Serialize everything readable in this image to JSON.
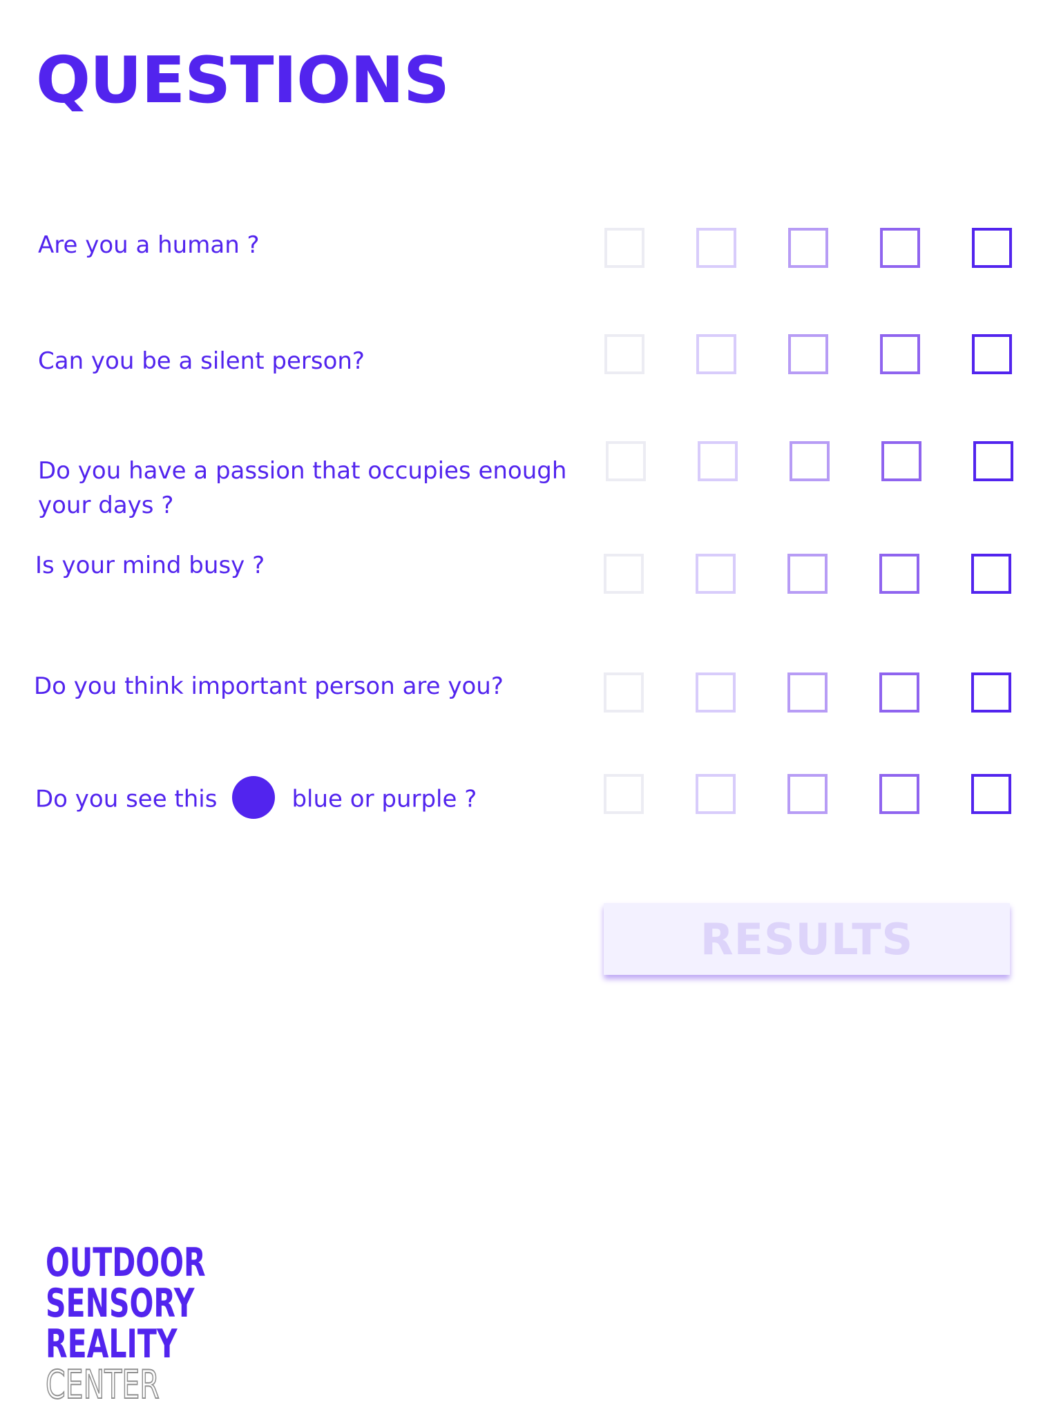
{
  "title": "QUESTIONS",
  "colors": {
    "accent": "#5224ee",
    "scale": [
      "#ececf3",
      "#d8ccfb",
      "#b79cf5",
      "#8f64ef",
      "#5224ee"
    ],
    "button_bg": "#f3f1ff",
    "button_text": "#ddd4fa",
    "button_shadow": "#bea8f5",
    "logo_outline": "#8f8f8f",
    "dot": "#5224ee"
  },
  "questions": [
    {
      "text": "Are you a human ?"
    },
    {
      "text": "Can you be a silent person?"
    },
    {
      "text": "Do you have a passion that occupies enough your days ?"
    },
    {
      "text": "Is your mind busy ?"
    },
    {
      "text": "Do you think important person are you?"
    },
    {
      "text_before": "Do you see this",
      "text_after": "blue or purple ?",
      "dot_color": "#5224ee"
    }
  ],
  "scale_points": 5,
  "results_label": "RESULTS",
  "logo": {
    "lines": [
      "OUTDOOR",
      "SENSORY",
      "REALITY"
    ],
    "outline_line": "CENTER"
  }
}
